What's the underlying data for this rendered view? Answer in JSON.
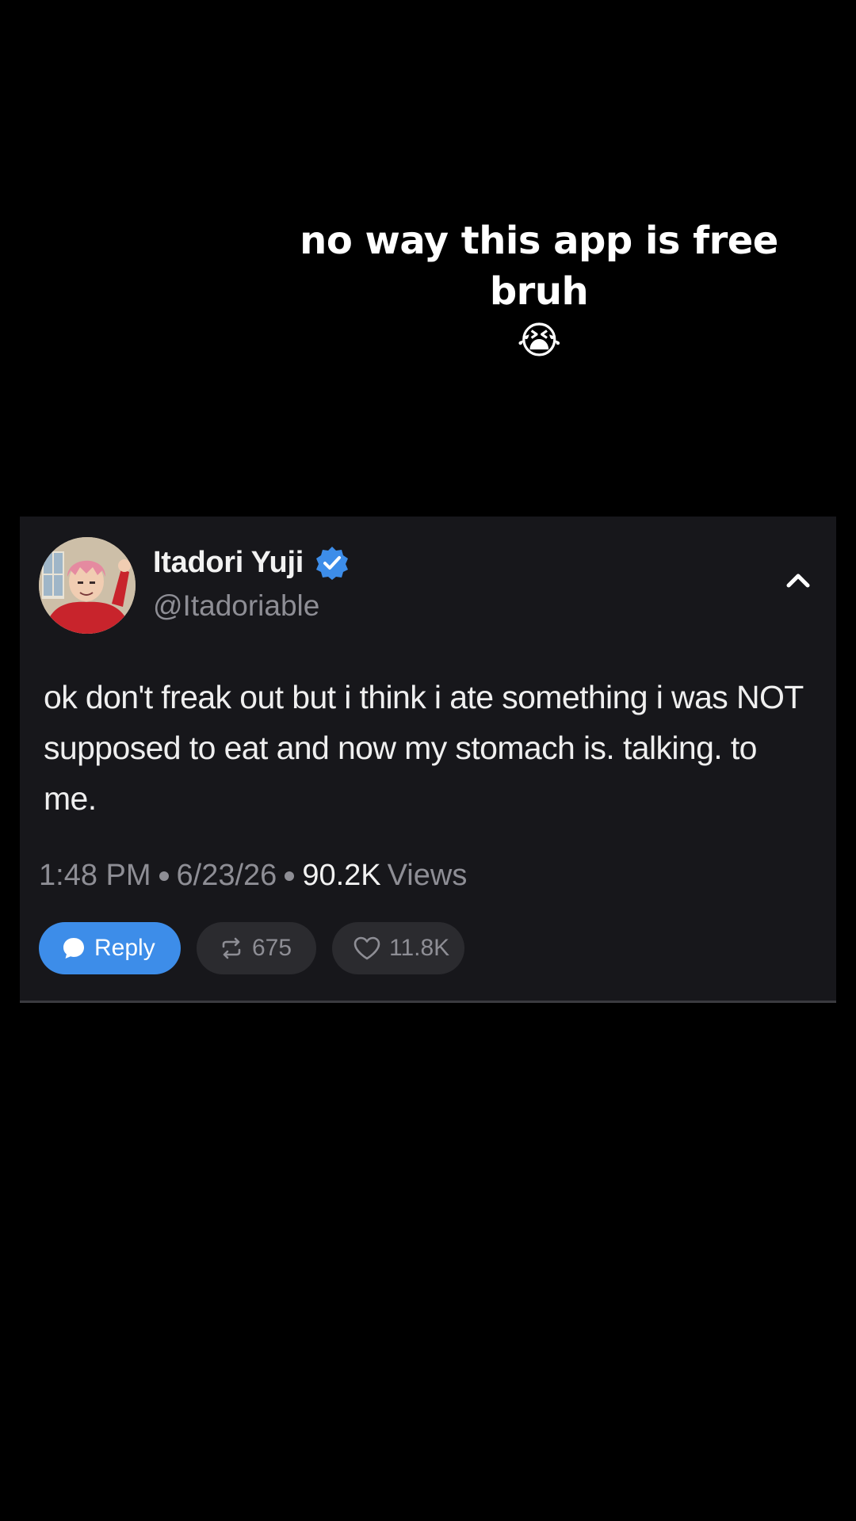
{
  "overlay": {
    "caption": "no way this app is free bruh",
    "caption_emoji": "😭"
  },
  "post": {
    "author": {
      "name": "Itadori Yuji",
      "handle": "@Itadoriable",
      "verified": true
    },
    "text": "ok don't freak out but i think i ate something i was NOT supposed to eat and now my stomach is. talking. to me.",
    "time": "1:48 PM",
    "date": "6/23/26",
    "views_count": "90.2K",
    "views_label": "Views",
    "actions": {
      "reply_label": "Reply",
      "repost_count": "675",
      "like_count": "11.8K"
    }
  },
  "colors": {
    "background": "#000000",
    "card": "#17171b",
    "accent": "#3d8de9",
    "muted_text": "#8e8e95",
    "pill": "#2b2b2f"
  },
  "icons": [
    "verified-badge-icon",
    "chevron-up-icon",
    "chat-bubble-icon",
    "repost-icon",
    "heart-icon"
  ]
}
